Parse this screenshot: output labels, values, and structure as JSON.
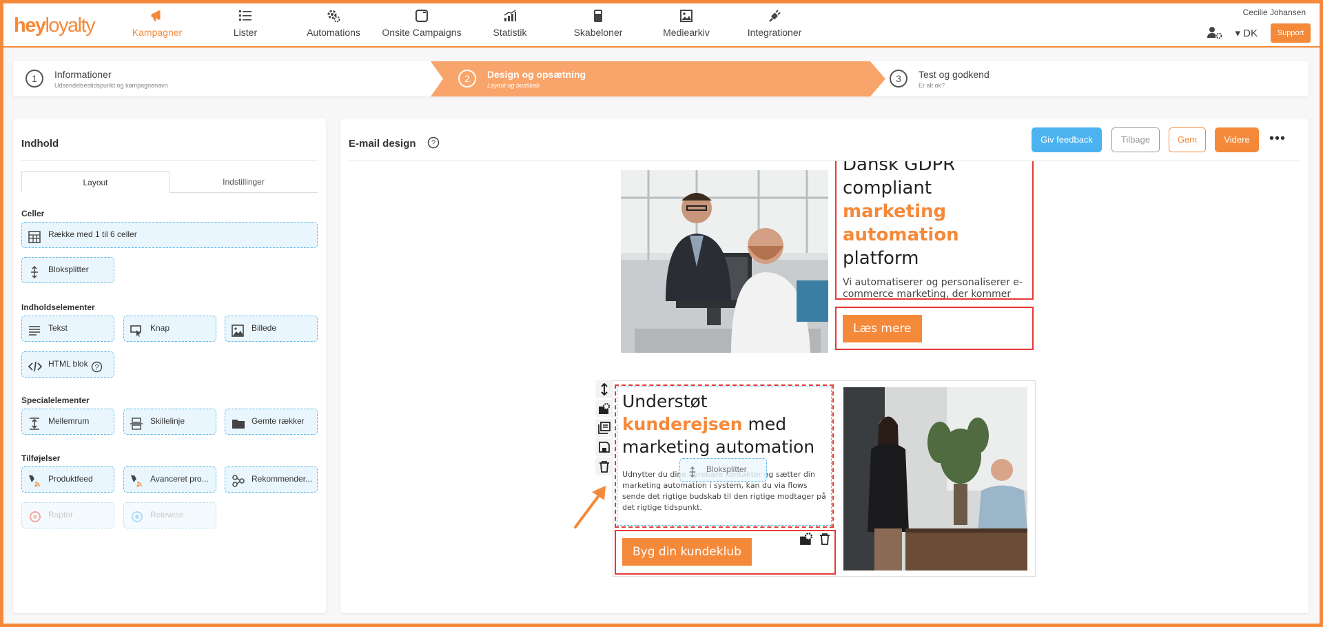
{
  "app": {
    "logo_bold": "hey",
    "logo_light": "loyalty",
    "brand_color": "#f5893a"
  },
  "nav": {
    "items": [
      {
        "label": "Kampagner",
        "icon": "megaphone-icon",
        "active": true
      },
      {
        "label": "Lister",
        "icon": "list-icon"
      },
      {
        "label": "Automations",
        "icon": "cogs-icon"
      },
      {
        "label": "Onsite Campaigns",
        "icon": "window-icon"
      },
      {
        "label": "Statistik",
        "icon": "chart-icon"
      },
      {
        "label": "Skabeloner",
        "icon": "template-icon"
      },
      {
        "label": "Mediearkiv",
        "icon": "image-icon"
      },
      {
        "label": "Integrationer",
        "icon": "plug-icon"
      }
    ],
    "user_name": "Cecilie Johansen",
    "language": "▾ DK",
    "support": "Support"
  },
  "stepper": {
    "steps": [
      {
        "num": "1",
        "title": "Informationer",
        "sub": "Udsendelsestidspunkt og kampagnenavn"
      },
      {
        "num": "2",
        "title": "Design og opsætning",
        "sub": "Layout og budskab",
        "active": true
      },
      {
        "num": "3",
        "title": "Test og godkend",
        "sub": "Er alt ok?"
      }
    ]
  },
  "left": {
    "title": "Indhold",
    "tabs": [
      "Layout",
      "Indstillinger"
    ],
    "sections": {
      "celler": "Celler",
      "indholdselementer": "Indholdselementer",
      "specialelementer": "Specialelementer",
      "tilfoejelser": "Tilføjelser"
    },
    "chips": {
      "row": "Række med 1 til 6 celler",
      "splitter": "Bloksplitter",
      "text": "Tekst",
      "button": "Knap",
      "image": "Billede",
      "html": "HTML blok",
      "spacer": "Mellemrum",
      "divider": "Skillelinje",
      "saved_rows": "Gemte rækker",
      "productfeed": "Produktfeed",
      "advanced": "Avanceret pro...",
      "recommend": "Rekommender...",
      "raptor": "Raptor",
      "relewise": "Relewise"
    }
  },
  "editor": {
    "title": "E-mail design",
    "buttons": {
      "feedback": "Giv feedback",
      "back": "Tilbage",
      "save": "Gem",
      "next": "Videre",
      "more": "•••"
    },
    "block1": {
      "h_top": "Dansk GDPR",
      "h_pre": "compliant ",
      "h_hl": "marketing automation",
      "h_post": " platform",
      "body": "Vi automatiserer og personaliserer e-commerce marketing, der kommer hele vejen rundt om din forretning. Fra første besøg på din webshop til loyalitetsklubber.",
      "cta": "Læs mere"
    },
    "block2": {
      "h_pre": "Understøt ",
      "h_hl": "kunderejsen",
      "h_post": " med marketing automation",
      "body": "Udnytter du dine dyrebare kontakter og sætter din marketing automation i system, kan du via flows sende det rigtige budskab til den rigtige modtager på det rigtige tidspunkt.",
      "cta": "Byg din kundeklub"
    },
    "drag_ghost": "Bloksplitter"
  }
}
